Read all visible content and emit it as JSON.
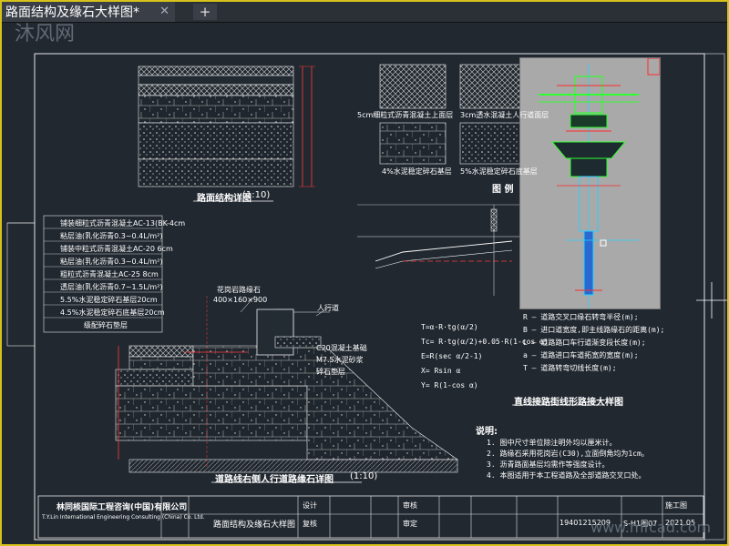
{
  "window": {
    "tab_title": "路面结构及缘石大样图*",
    "tab_close": "✕",
    "tab_add": "+"
  },
  "watermarks": {
    "top_left": "沐风网",
    "bottom_right": "www.mfcad.com"
  },
  "drawing": {
    "section1_title": "路面结构详图",
    "section1_scale": "(1:10)",
    "section2_title": "道路线右侧人行道路缘石详图",
    "section2_scale": "(1:10)",
    "section3_title": "直线接路街线形路接大样图",
    "legend_title": "图 例",
    "legend_items": [
      "5cm细粒式沥青混凝土上面层",
      "3cm透水混凝土人行道面层",
      "4%水泥稳定碎石基层",
      "5%水泥稳定碎石底基层"
    ],
    "layer_labels": [
      "铺装细粒式沥青混凝土AC-13(BK-4cm",
      "粘层油(乳化沥青0.3~0.4L/m²)",
      "铺装中粒式沥青混凝土AC-20 6cm",
      "粘层油(乳化沥青0.3~0.4L/m²)",
      "粗粒式沥青混凝土AC-25 8cm",
      "透层油(乳化沥青0.7~1.5L/m²)",
      "5.5%水泥稳定碎石基层20cm",
      "4.5%水泥稳定碎石底基层20cm",
      "级配碎石垫层"
    ],
    "curb_labels": [
      "花岗岩路缘石",
      "人行道",
      "400×160×900",
      "C20混凝土基础",
      "M7.5水泥砂浆",
      "碎石垫层"
    ],
    "formula_lines": [
      "T=α·R·tg(α/2)",
      "Tc= R·tg(α/2)+0.05·R(1-cos α)",
      "E=R(sec α/2-1)",
      "X= Rsin α",
      "Y= R(1-cos α)"
    ],
    "notes_title": "说明:",
    "notes": [
      "1. 图中尺寸单位除注明外均以厘米计。",
      "2. 路缘石采用花岗岩(C30),立面倒角均为1cm。",
      "3. 沥青路面基层均需作等强度设计。",
      "4. 本图适用于本工程道路及全部道路交叉口处。"
    ],
    "symbol_notes": [
      "R — 道路交叉口缘石转弯半径(m);",
      "B — 进口道宽度,即主线路缘石的距离(m);",
      "L — 道路路口车行道渐变段长度(m);",
      "a — 道路进口车道拓宽的宽度(m);",
      "T — 道路转弯切线长度(m);"
    ]
  },
  "title_block": {
    "company": "林同棪国际工程咨询(中国)有限公司",
    "company_en": "T.Y.Lin International Engineering Consulting (China) Co. Ltd.",
    "project": "路面结构及缘石大样图",
    "role1": "设计",
    "role2": "复核",
    "role3": "审核",
    "role4": "审定",
    "drawing_no": "19401215209",
    "stage": "施工图",
    "date": "2021.05",
    "sheet": "S-H1图07"
  },
  "colors": {
    "frame_border": "#d6c21a",
    "canvas_bg": "#212830",
    "line_white": "#ffffff",
    "line_yellow": "#e8e55a",
    "line_cyan": "#6ee6e6",
    "line_green": "#3cff3c",
    "line_red": "#ff3030"
  }
}
